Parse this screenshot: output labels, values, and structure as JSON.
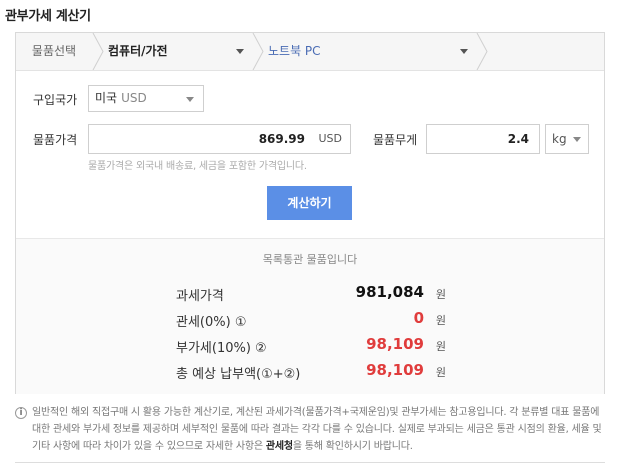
{
  "title": "관부가세 계산기",
  "category": {
    "label": "물품선택",
    "primary": "컴퓨터/가전",
    "secondary": "노트북 PC"
  },
  "country": {
    "label": "구입국가",
    "value": "미국",
    "currency": "USD"
  },
  "price": {
    "label": "물품가격",
    "value": "869.99",
    "unit": "USD",
    "hint": "물품가격은 외국내 배송료, 세금을 포함한 가격입니다."
  },
  "weight": {
    "label": "물품무게",
    "value": "2.4",
    "unit": "kg"
  },
  "calc_button": "계산하기",
  "result": {
    "heading": "목록통관 물품입니다",
    "rows": [
      {
        "label": "과세가격",
        "value": "981,084",
        "unit": "원",
        "color": "#111111"
      },
      {
        "label": "관세(0%) ①",
        "value": "0",
        "unit": "원",
        "color": "#e03c3c"
      },
      {
        "label": "부가세(10%) ②",
        "value": "98,109",
        "unit": "원",
        "color": "#e03c3c"
      },
      {
        "label": "총 예상 납부액(①+②)",
        "value": "98,109",
        "unit": "원",
        "color": "#e03c3c"
      }
    ]
  },
  "footnote": {
    "icon": "info-icon",
    "text_before": "일반적인 해외 직접구매 시 활용 가능한 계산기로, 계산된 과세가격(물품가격+국제운임)및 관부가세는 참고용입니다. 각 분류별 대표 물품에 대한 관세와 부가세 정보를 제공하며 세부적인 물품에 따라 결과는 각각 다를 수 있습니다. 실제로 부과되는 세금은 통관 시점의 환율, 세율 및 기타 사항에 따라 차이가 있을 수 있으므로 자세한 사항은 ",
    "link": "관세청",
    "text_after": "을 통해 확인하시기 바랍니다."
  },
  "colors": {
    "accent_button": "#5b8fe6",
    "red_value": "#e03c3c",
    "link_blue": "#4a6cb4"
  }
}
